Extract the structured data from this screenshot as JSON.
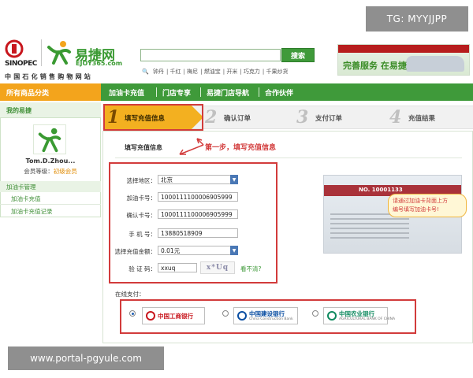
{
  "watermarks": {
    "top": "TG: MYYJJPP",
    "bottom": "www.portal-pgyule.com"
  },
  "header": {
    "partner_logo_text": "SINOPEC",
    "brand_name": "易捷网",
    "brand_url": "EJOY365.com",
    "tagline": "中国石化销售购物网站",
    "search_placeholder": "",
    "search_button": "搜索",
    "hot_links": [
      "钟丹",
      "千红",
      "梅尼",
      "燃油宝",
      "开米",
      "巧克力",
      "千果炒货"
    ],
    "banner_text": "完善服务 在易捷"
  },
  "nav": {
    "category": "所有商品分类",
    "items": [
      "加油卡充值",
      "门店专享",
      "易捷门店导航",
      "合作伙伴"
    ]
  },
  "sidebar": {
    "title": "我的易捷",
    "username": "Tom.D.Zhou...",
    "level_label": "会员等级：",
    "level_value": "初级会员",
    "section": "加油卡管理",
    "links": [
      "加油卡充值",
      "加油卡充值记录"
    ]
  },
  "steps": [
    {
      "num": "1",
      "label": "填写充值信息"
    },
    {
      "num": "2",
      "label": "确认订单"
    },
    {
      "num": "3",
      "label": "支付订单"
    },
    {
      "num": "4",
      "label": "充值结果"
    }
  ],
  "form": {
    "section_title": "填写充值信息",
    "annotation": "第一步，填写充值信息",
    "fields": {
      "region": {
        "label": "选择地区：",
        "value": "北京"
      },
      "card_no": {
        "label": "加油卡号：",
        "value": "1000111100006905999"
      },
      "confirm_card_no": {
        "label": "确认卡号：",
        "value": "1000111100006905999"
      },
      "phone": {
        "label": "手 机 号：",
        "value": "13880518909"
      },
      "amount": {
        "label": "选择充值金额：",
        "value": "0.01元"
      },
      "captcha": {
        "label": "验 证 码：",
        "value": "xxuq",
        "image_text": "x*Uq",
        "refresh": "看不清?"
      }
    }
  },
  "card": {
    "number": "NO. 10001133",
    "tip_lines": [
      "请通过加油卡背面上方",
      "编号填写加油卡号!"
    ]
  },
  "payment": {
    "label": "在线支付：",
    "selected": "icbc",
    "banks": [
      {
        "id": "icbc",
        "name": "中国工商银行",
        "sub": "",
        "color": "#c8161d"
      },
      {
        "id": "ccb",
        "name": "中国建设银行",
        "sub": "China Construction Bank",
        "color": "#0a4ea2"
      },
      {
        "id": "abc",
        "name": "中国农业银行",
        "sub": "AGRICULTURAL BANK OF CHINA",
        "color": "#0f8a5f"
      }
    ]
  },
  "colors": {
    "primary_green": "#3f9a3a",
    "accent_orange": "#f3a41c",
    "highlight_red": "#d23b3b"
  }
}
